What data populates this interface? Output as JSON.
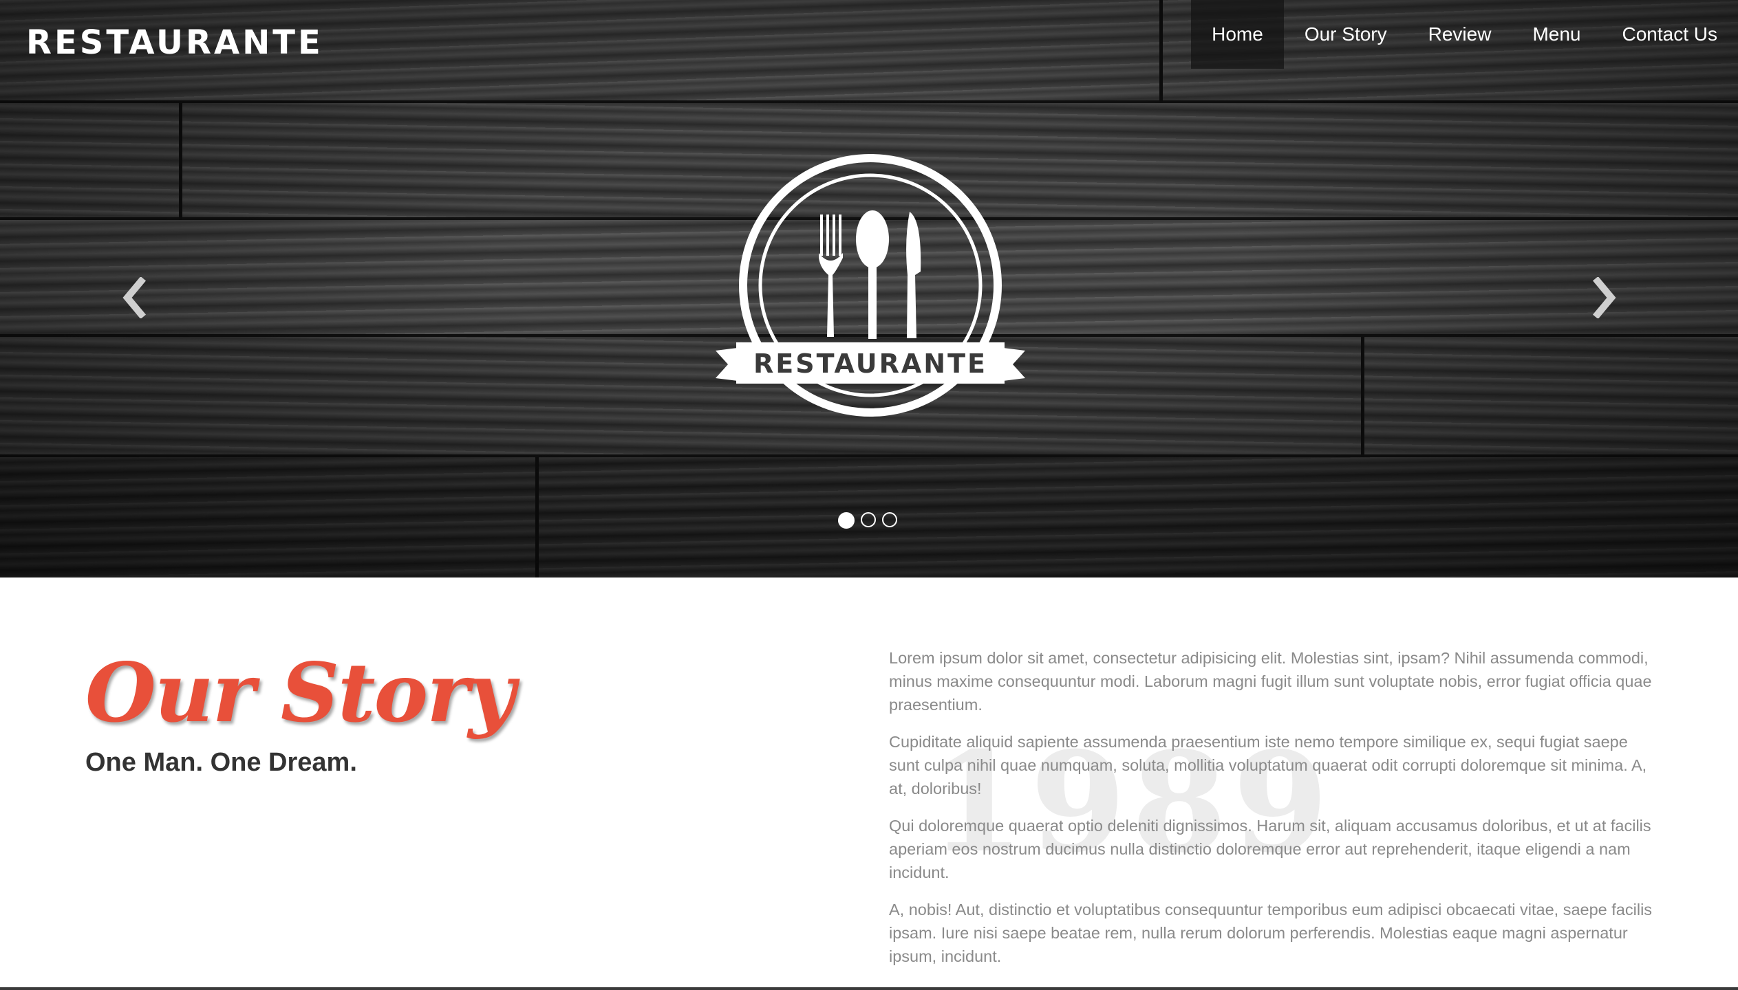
{
  "brand": {
    "logo_text": "RESTAURANTE"
  },
  "nav": {
    "items": [
      {
        "label": "Home",
        "active": true
      },
      {
        "label": "Our Story",
        "active": false
      },
      {
        "label": "Review",
        "active": false
      },
      {
        "label": "Menu",
        "active": false
      },
      {
        "label": "Contact Us",
        "active": false
      }
    ]
  },
  "hero": {
    "emblem_text": "RESTAURANTE",
    "emblem_icons": [
      "fork-icon",
      "spoon-icon",
      "knife-icon"
    ],
    "carousel": {
      "slide_count": 3,
      "active_slide": 1,
      "prev_icon": "chevron-left-icon",
      "next_icon": "chevron-right-icon"
    }
  },
  "story": {
    "title": "Our Story",
    "subtitle": "One Man. One Dream.",
    "watermark_year": "1989",
    "paragraphs": [
      "Lorem ipsum dolor sit amet, consectetur adipisicing elit. Molestias sint, ipsam? Nihil assumenda commodi, minus maxime consequuntur modi. Laborum magni fugit illum sunt voluptate nobis, error fugiat officia quae praesentium.",
      "Cupiditate aliquid sapiente assumenda praesentium iste nemo tempore similique ex, sequi fugiat saepe sunt culpa nihil quae numquam, soluta, mollitia voluptatum quaerat odit corrupti doloremque sit minima. A, at, doloribus!",
      "Qui doloremque quaerat optio deleniti dignissimos. Harum sit, aliquam accusamus doloribus, et ut at facilis aperiam eos nostrum ducimus nulla distinctio doloremque error aut reprehenderit, itaque eligendi a nam incidunt.",
      "A, nobis! Aut, distinctio et voluptatibus consequuntur temporibus eum adipisci obcaecati vitae, saepe facilis ipsam. Iure nisi saepe beatae rem, nulla rerum dolorum perferendis. Molestias eaque magni aspernatur ipsum, incidunt."
    ]
  },
  "colors": {
    "accent": "#e8503a",
    "heading": "#333333",
    "body_text": "#8a8a8a",
    "nav_text": "#ffffff"
  }
}
